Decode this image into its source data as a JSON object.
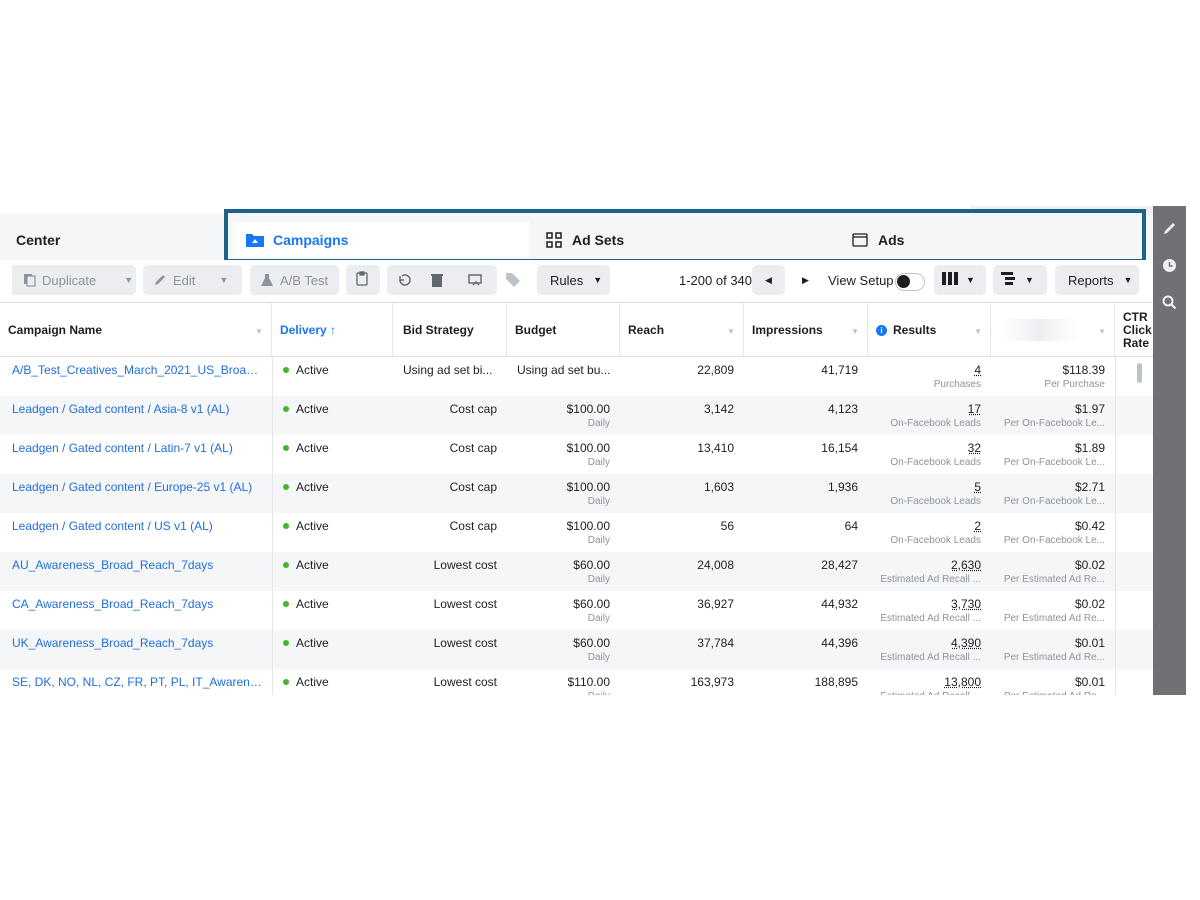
{
  "app": {
    "section_title": "Center",
    "tabs": [
      {
        "label": "Campaigns",
        "icon": "folder-icon",
        "active": true
      },
      {
        "label": "Ad Sets",
        "icon": "grid-icon",
        "active": false
      },
      {
        "label": "Ads",
        "icon": "window-icon",
        "active": false
      }
    ],
    "accent_color": "#1877f2",
    "highlight_border_color": "#1f6287"
  },
  "toolbar": {
    "duplicate_label": "Duplicate",
    "edit_label": "Edit",
    "ab_test_label": "A/B Test",
    "rules_label": "Rules",
    "pager_text": "1-200 of 340",
    "view_setup_label": "View Setup",
    "reports_label": "Reports"
  },
  "table": {
    "headers": {
      "campaign_name": "Campaign Name",
      "delivery": "Delivery ↑",
      "bid_strategy": "Bid Strategy",
      "budget": "Budget",
      "reach": "Reach",
      "impressions": "Impressions",
      "results": "Results",
      "ctr_1": "CTR",
      "ctr_2": "Click",
      "ctr_3": "Rate"
    },
    "rows": [
      {
        "name": "A/B_Test_Creatives_March_2021_US_Broad_...",
        "delivery": "Active",
        "bid": "Using ad set bi...",
        "budget": "Using ad set bu...",
        "budget_sub": "",
        "reach": "22,809",
        "impressions": "41,719",
        "results": "4",
        "results_sub": "Purchases",
        "cost": "$118.39",
        "cost_sub": "Per Purchase"
      },
      {
        "name": "Leadgen / Gated content / Asia-8 v1 (AL)",
        "delivery": "Active",
        "bid": "Cost cap",
        "budget": "$100.00",
        "budget_sub": "Daily",
        "reach": "3,142",
        "impressions": "4,123",
        "results": "17",
        "results_sub": "On-Facebook Leads",
        "cost": "$1.97",
        "cost_sub": "Per On-Facebook Le..."
      },
      {
        "name": "Leadgen / Gated content / Latin-7 v1 (AL)",
        "delivery": "Active",
        "bid": "Cost cap",
        "budget": "$100.00",
        "budget_sub": "Daily",
        "reach": "13,410",
        "impressions": "16,154",
        "results": "32",
        "results_sub": "On-Facebook Leads",
        "cost": "$1.89",
        "cost_sub": "Per On-Facebook Le..."
      },
      {
        "name": "Leadgen / Gated content / Europe-25 v1 (AL)",
        "delivery": "Active",
        "bid": "Cost cap",
        "budget": "$100.00",
        "budget_sub": "Daily",
        "reach": "1,603",
        "impressions": "1,936",
        "results": "5",
        "results_sub": "On-Facebook Leads",
        "cost": "$2.71",
        "cost_sub": "Per On-Facebook Le..."
      },
      {
        "name": "Leadgen / Gated content / US v1 (AL)",
        "delivery": "Active",
        "bid": "Cost cap",
        "budget": "$100.00",
        "budget_sub": "Daily",
        "reach": "56",
        "impressions": "64",
        "results": "2",
        "results_sub": "On-Facebook Leads",
        "cost": "$0.42",
        "cost_sub": "Per On-Facebook Le..."
      },
      {
        "name": "AU_Awareness_Broad_Reach_7days",
        "delivery": "Active",
        "bid": "Lowest cost",
        "budget": "$60.00",
        "budget_sub": "Daily",
        "reach": "24,008",
        "impressions": "28,427",
        "results": "2,630",
        "results_sub": "Estimated Ad Recall ...",
        "cost": "$0.02",
        "cost_sub": "Per Estimated Ad Re..."
      },
      {
        "name": "CA_Awareness_Broad_Reach_7days",
        "delivery": "Active",
        "bid": "Lowest cost",
        "budget": "$60.00",
        "budget_sub": "Daily",
        "reach": "36,927",
        "impressions": "44,932",
        "results": "3,730",
        "results_sub": "Estimated Ad Recall ...",
        "cost": "$0.02",
        "cost_sub": "Per Estimated Ad Re..."
      },
      {
        "name": "UK_Awareness_Broad_Reach_7days",
        "delivery": "Active",
        "bid": "Lowest cost",
        "budget": "$60.00",
        "budget_sub": "Daily",
        "reach": "37,784",
        "impressions": "44,396",
        "results": "4,390",
        "results_sub": "Estimated Ad Recall ...",
        "cost": "$0.01",
        "cost_sub": "Per Estimated Ad Re..."
      },
      {
        "name": "SE, DK, NO, NL, CZ, FR, PT, PL, IT_Awareness_...",
        "delivery": "Active",
        "bid": "Lowest cost",
        "budget": "$110.00",
        "budget_sub": "Daily",
        "reach": "163,973",
        "impressions": "188,895",
        "results": "13,800",
        "results_sub": "Estimated Ad Recall ...",
        "cost": "$0.01",
        "cost_sub": "Per Estimated Ad Re..."
      }
    ]
  },
  "rail": {
    "icons": [
      "pencil-icon",
      "clock-icon",
      "zoom-icon"
    ]
  }
}
